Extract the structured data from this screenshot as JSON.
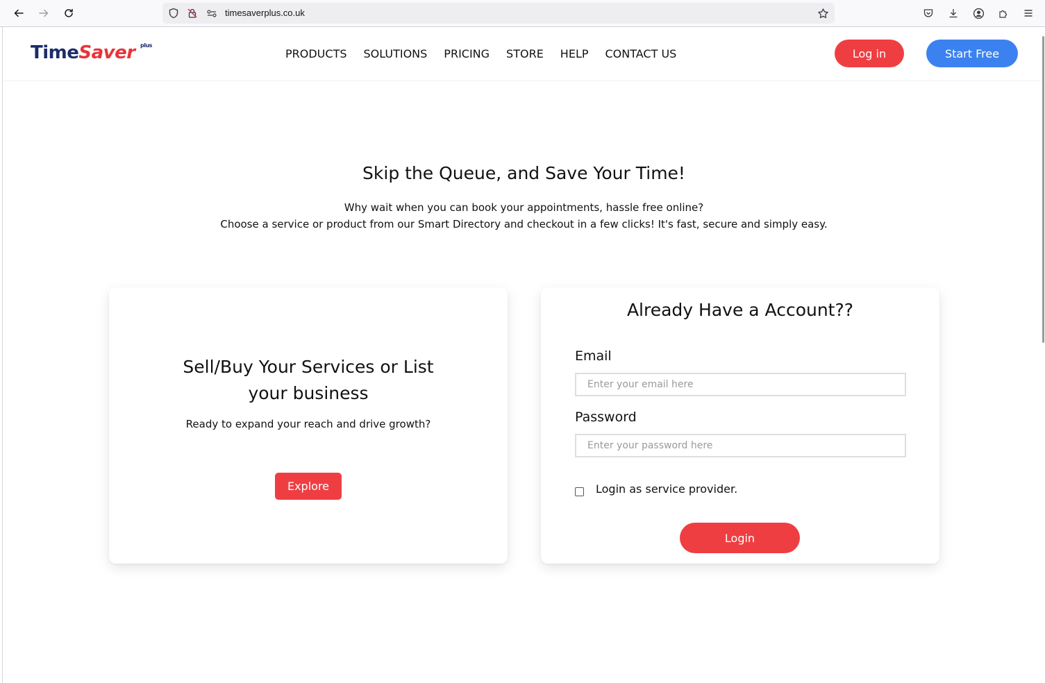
{
  "browser": {
    "url": "timesaverplus.co.uk"
  },
  "brand": {
    "logo_time": "Time",
    "logo_saver": "Saver",
    "logo_plus": "plus",
    "primary_red": "#ef3e42",
    "primary_blue": "#3b82f0",
    "logo_navy": "#1c2d6b"
  },
  "header": {
    "menu": [
      "PRODUCTS",
      "SOLUTIONS",
      "PRICING",
      "STORE",
      "HELP",
      "CONTACT US"
    ],
    "login_label": "Log in",
    "start_label": "Start Free"
  },
  "hero": {
    "title": "Skip the Queue, and Save Your Time!",
    "line1": "Why wait when you can book your appointments, hassle free online?",
    "line2": "Choose a service or product from our Smart Directory and checkout in a few clicks! It's fast, secure and simply easy."
  },
  "sell_card": {
    "title_line1": "Sell/Buy Your Services or List",
    "title_line2": "your business",
    "subtitle": "Ready to expand your reach and drive growth?",
    "explore_label": "Explore"
  },
  "login_card": {
    "title": "Already Have a Account??",
    "email_label": "Email",
    "email_placeholder": "Enter your email here",
    "email_value": "",
    "password_label": "Password",
    "password_placeholder": "Enter your password here",
    "password_value": "",
    "provider_label": "Login as service provider.",
    "provider_checked": false,
    "login_label": "Login"
  }
}
